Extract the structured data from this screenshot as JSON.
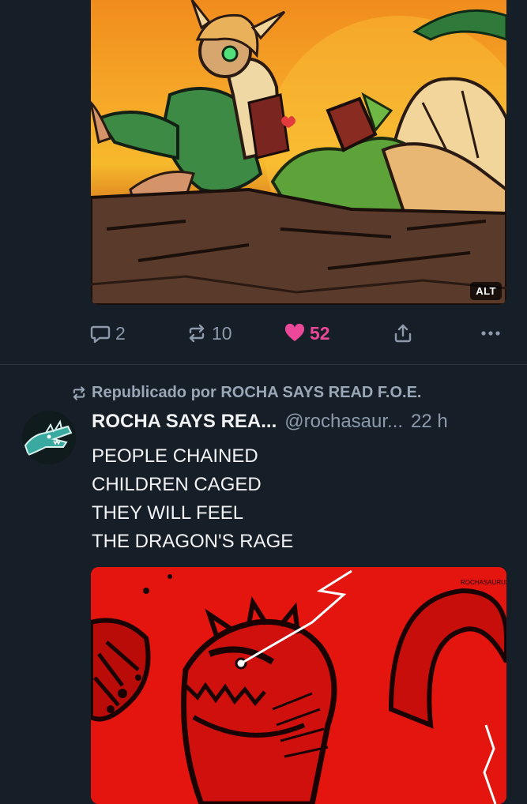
{
  "post1": {
    "alt_badge": "ALT",
    "actions": {
      "replies": "2",
      "reposts": "10",
      "likes": "52"
    },
    "colors": {
      "like_active": "#ec4899",
      "action_icon": "#8c9aab"
    }
  },
  "post2": {
    "repost_label": "Republicado por ROCHA SAYS READ F.O.E.",
    "author_name": "ROCHA SAYS REA...",
    "author_handle": "@rochasaur...",
    "time": "22 h",
    "text_lines": [
      "PEOPLE CHAINED",
      "CHILDREN CAGED",
      "THEY WILL FEEL",
      "THE DRAGON'S RAGE"
    ],
    "media_watermark": "ROCHASAURUSREX"
  },
  "icons": {
    "reply": "speech-bubble-icon",
    "repost": "repost-arrows-icon",
    "like": "heart-icon",
    "share": "share-upload-icon",
    "more": "ellipsis-icon"
  },
  "theme": {
    "background": "#161e27",
    "divider": "#2b3744",
    "text_primary": "#f1f3f5",
    "text_secondary": "#8c9aab"
  }
}
